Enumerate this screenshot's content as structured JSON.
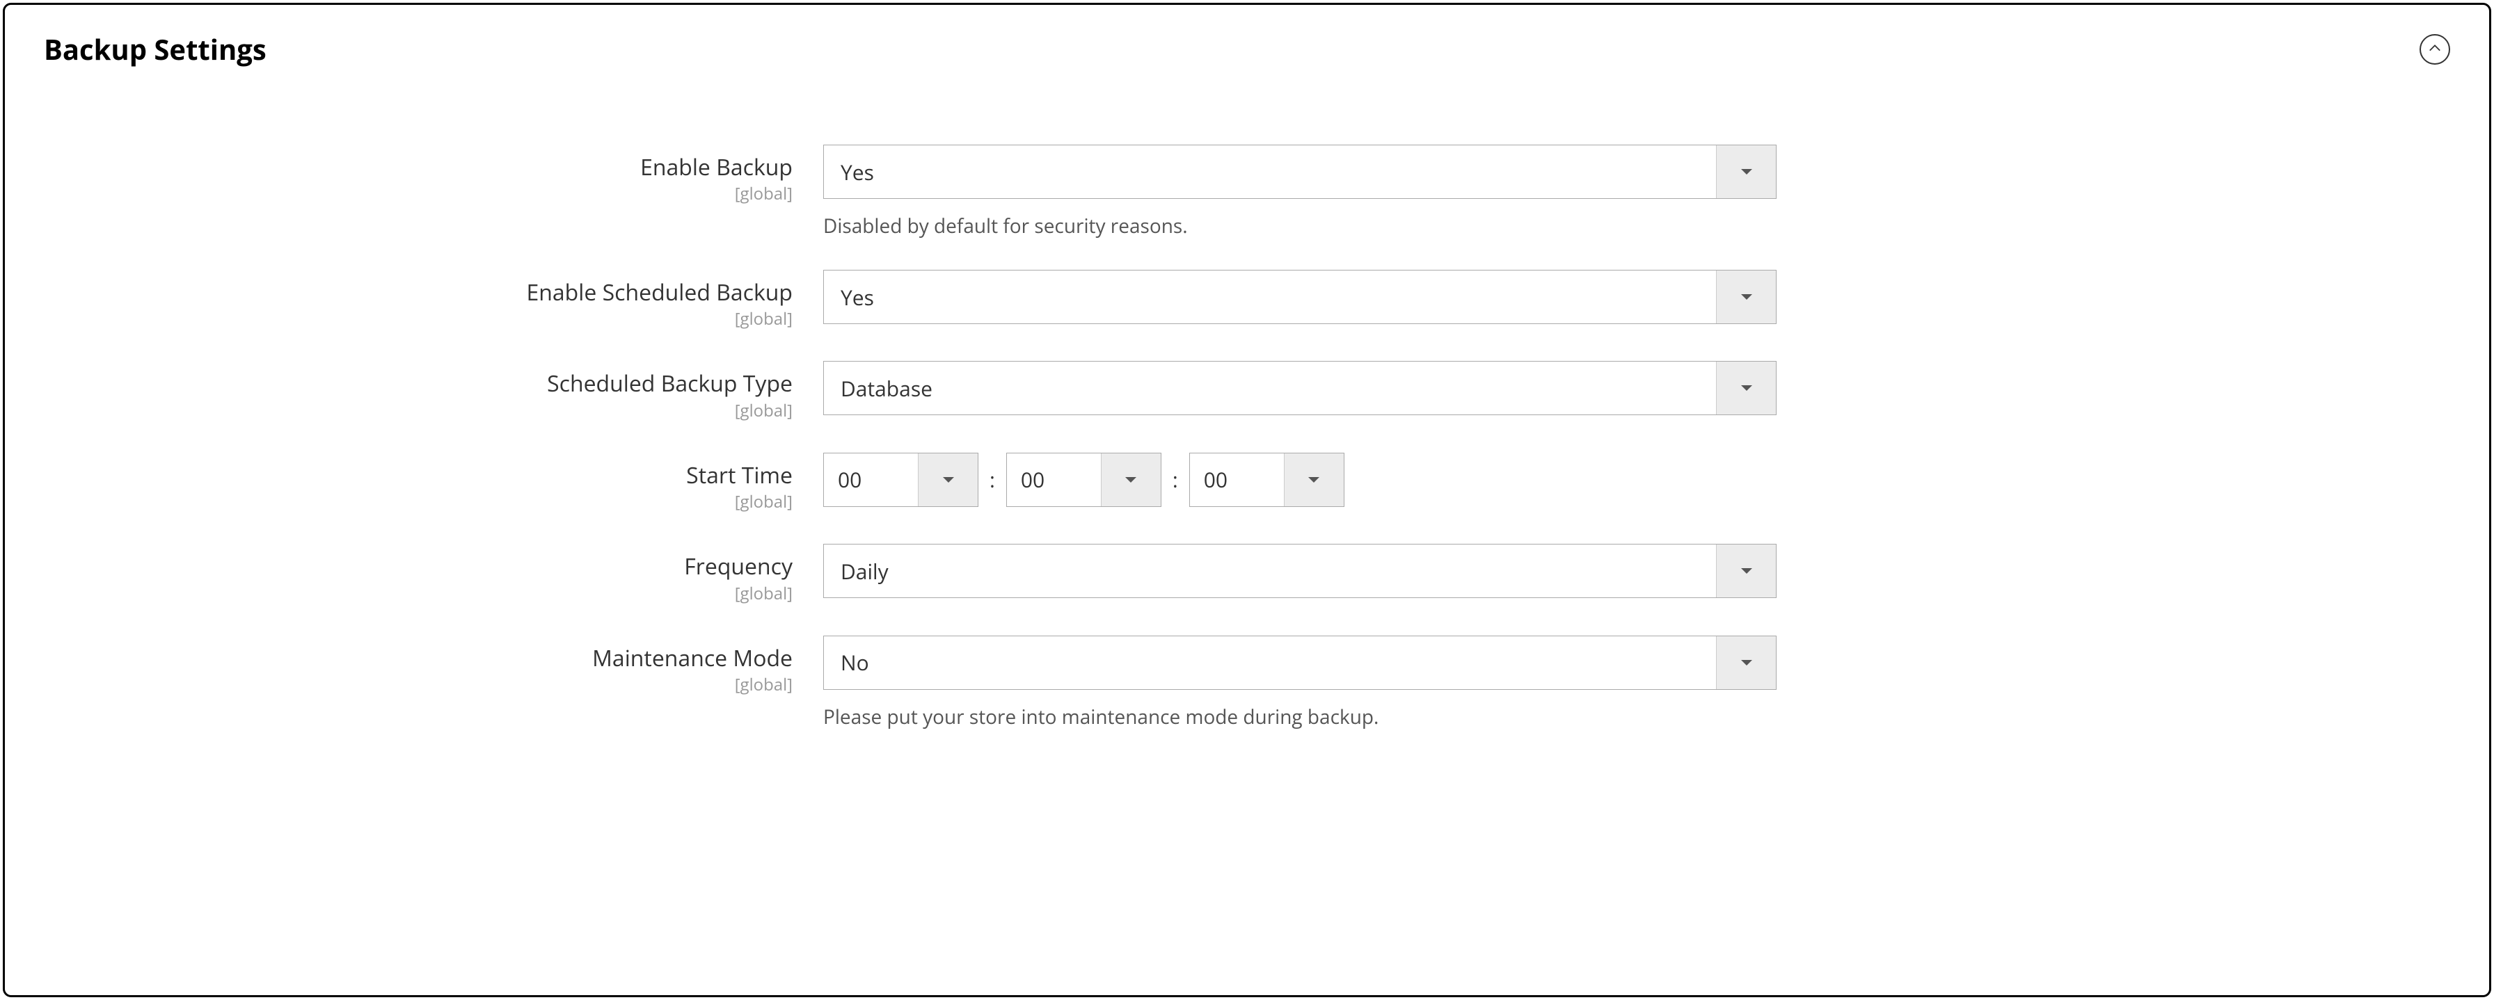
{
  "panel": {
    "title": "Backup Settings"
  },
  "scope": "[global]",
  "time_sep": ":",
  "fields": {
    "enable_backup": {
      "label": "Enable Backup",
      "value": "Yes",
      "helper": "Disabled by default for security reasons."
    },
    "enable_scheduled_backup": {
      "label": "Enable Scheduled Backup",
      "value": "Yes"
    },
    "scheduled_backup_type": {
      "label": "Scheduled Backup Type",
      "value": "Database"
    },
    "start_time": {
      "label": "Start Time",
      "hour": "00",
      "minute": "00",
      "second": "00"
    },
    "frequency": {
      "label": "Frequency",
      "value": "Daily"
    },
    "maintenance_mode": {
      "label": "Maintenance Mode",
      "value": "No",
      "helper": "Please put your store into maintenance mode during backup."
    }
  }
}
